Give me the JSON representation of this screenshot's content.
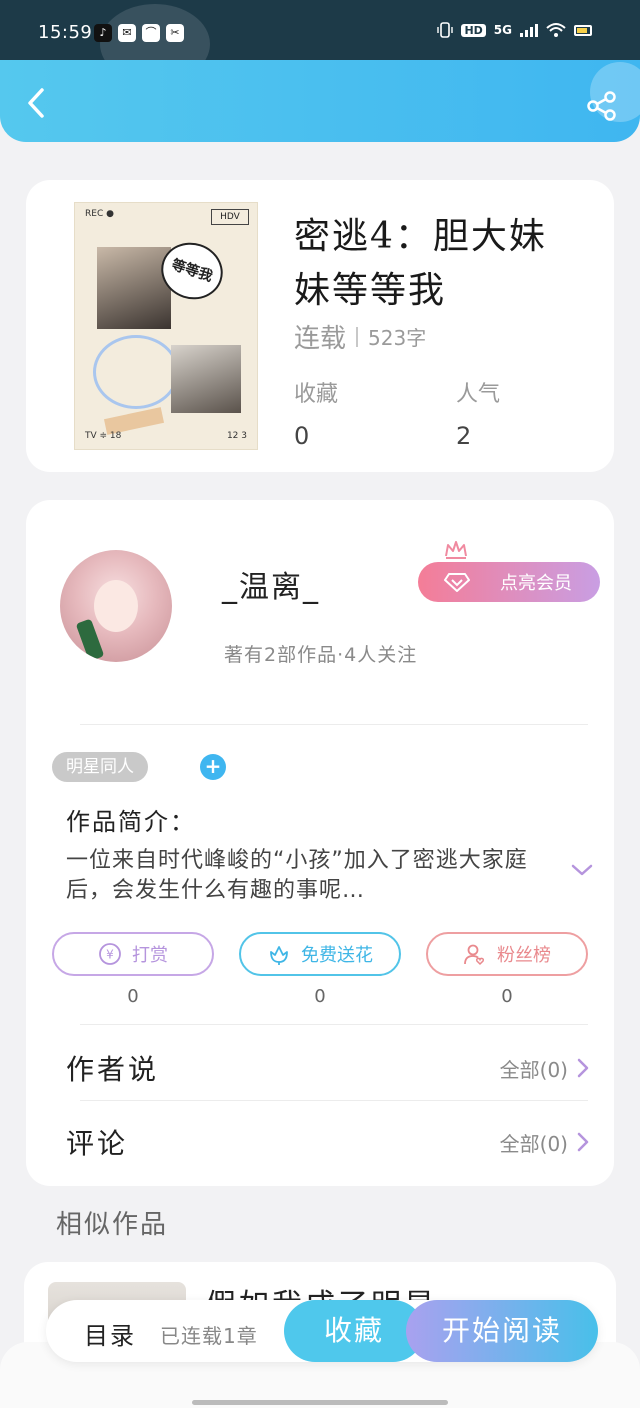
{
  "status_bar": {
    "time": "15:59",
    "apps": [
      "♪",
      "✉",
      "⌒",
      "✂"
    ],
    "hd": "HD",
    "network": "5G"
  },
  "header": {
    "back_icon": "back-arrow-icon",
    "share_icon": "share-icon"
  },
  "book": {
    "cover_rec": "REC ●",
    "cover_hdv": "HDV",
    "cover_bubble": "等等我",
    "cover_footer_left": "TV ≑ 18",
    "cover_footer_right": "12 3",
    "title": "密逃4：胆大妹妹等等我",
    "status": "连载",
    "word_count": "523字",
    "favorites_label": "收藏",
    "favorites_value": "0",
    "popularity_label": "人气",
    "popularity_value": "2"
  },
  "author": {
    "name": "_温离_",
    "works_info": "著有2部作品·4人关注",
    "vip_label": "点亮会员",
    "tag": "明星同人",
    "intro_label": "作品简介：",
    "intro_text": "一位来自时代峰峻的“小孩”加入了密逃大家庭后，会发生什么有趣的事呢…",
    "actions": {
      "tip_label": "打赏",
      "tip_count": "0",
      "flower_label": "免费送花",
      "flower_count": "0",
      "fans_label": "粉丝榜",
      "fans_count": "0"
    },
    "author_says_label": "作者说",
    "author_says_link": "全部(0)",
    "comments_label": "评论",
    "comments_link": "全部(0)"
  },
  "similar": {
    "title": "相似作品",
    "first_name": "假如我成了明星"
  },
  "bottom_bar": {
    "toc_label": "目录",
    "toc_status": "已连载1章",
    "favorite_button": "收藏",
    "read_button": "开始阅读"
  },
  "colors": {
    "accent_blue": "#3fb6f0",
    "vip_pink": "#f47d97",
    "vip_purple": "#c99ee3",
    "tip_purple": "#b594dd",
    "fans_red": "#e9898d"
  }
}
